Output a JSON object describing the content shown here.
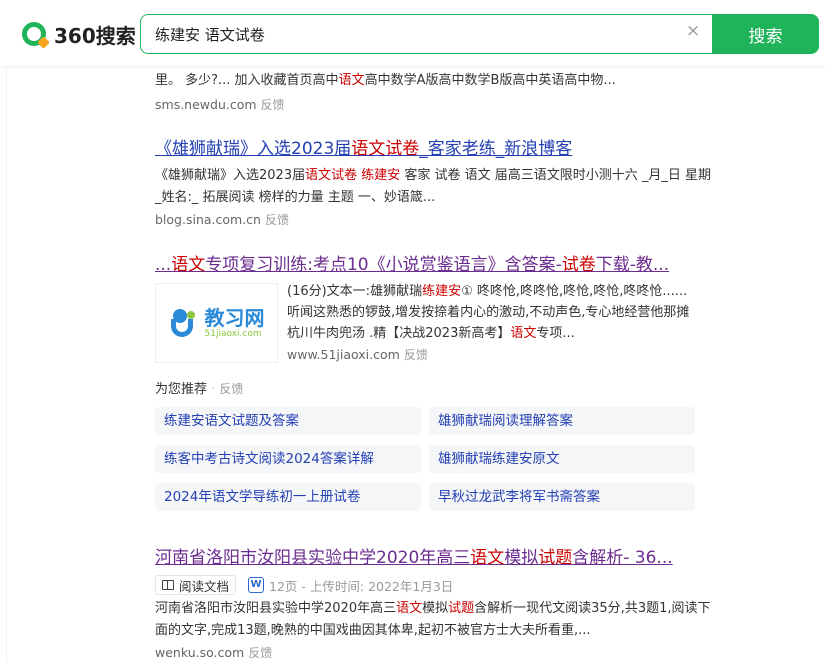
{
  "header": {
    "logo_text": "360搜索",
    "search_value": "练建安 语文试卷",
    "clear_symbol": "×",
    "search_button_label": "搜索"
  },
  "partial_result": {
    "line1_a": "里。 多少?... 加入收藏首页高中",
    "line1_hl": "语文",
    "line1_b": "高中数学A版高中数学B版高中英语高中物...",
    "url": "sms.newdu.com",
    "feedback": "反馈"
  },
  "result1": {
    "title_a": "《雄狮献瑞》入选2023届",
    "title_hl": "语文试卷",
    "title_b": "_客家老练_新浪博客",
    "snippet_a": "《雄狮献瑞》入选2023届",
    "snippet_hl1": "语文试卷",
    "snippet_sp": " ",
    "snippet_hl2": "练建安",
    "snippet_b": " 客家 试卷 语文 届高三语文限时小测十六 _月_日 星期_姓名:_ 拓展阅读 榜样的力量 主题 一、妙语箴...",
    "url": "blog.sina.com.cn",
    "feedback": "反馈"
  },
  "result2": {
    "title_a": "...",
    "title_hl1": "语文",
    "title_b": "专项复习训练:考点10《小说赏鉴语言》含答案-",
    "title_hl2": "试卷",
    "title_c": "下载-教...",
    "thumb_title": "教习网",
    "thumb_sub": "51jiaoxi.com",
    "snippet_a": "(16分)文本一:雄狮献瑞",
    "snippet_hl1": "练建安",
    "snippet_b": "① 咚咚怆,咚咚怆,咚怆,咚怆,咚咚怆......听闻这熟悉的锣鼓,增发按捺着内心的激动,不动声色,专心地经营他那摊杭川牛肉兜汤 .精【决战2023新高考】",
    "snippet_hl2": "语文",
    "snippet_c": "专项...",
    "url": "www.51jiaoxi.com",
    "feedback": "反馈"
  },
  "recommend": {
    "label": "为您推荐",
    "dot": " · ",
    "feedback": "反馈",
    "items": [
      "练建安语文试题及答案",
      "雄狮献瑞阅读理解答案",
      "练客中考古诗文阅读2024答案详解",
      "雄狮献瑞练建安原文",
      "2024年语文学导练初一上册试卷",
      "早秋过龙武李将军书斋答案"
    ]
  },
  "result3": {
    "title_a": "河南省洛阳市汝阳县实验中学2020年高三",
    "title_hl1": "语文",
    "title_b": "模拟",
    "title_hl2": "试题",
    "title_c": "含解析- 36...",
    "badge_label": "阅读文档",
    "w_icon": "W",
    "meta": "12页 - 上传时间: 2022年1月3日",
    "snippet_a": "河南省洛阳市汝阳县实验中学2020年高三",
    "snippet_hl1": "语文",
    "snippet_b": "模拟",
    "snippet_hl2": "试题",
    "snippet_c": "含解析一现代文阅读35分,共3题1,阅读下面的文字,完成13题,晚熟的中国戏曲因其体卑,起初不被官方士大夫所看重,...",
    "url": "wenku.so.com",
    "feedback": "反馈"
  },
  "colors": {
    "brand_green": "#1fb35a",
    "link_blue": "#2440b3",
    "visited_purple": "#6b2c8f",
    "highlight_red": "#cc0000"
  }
}
